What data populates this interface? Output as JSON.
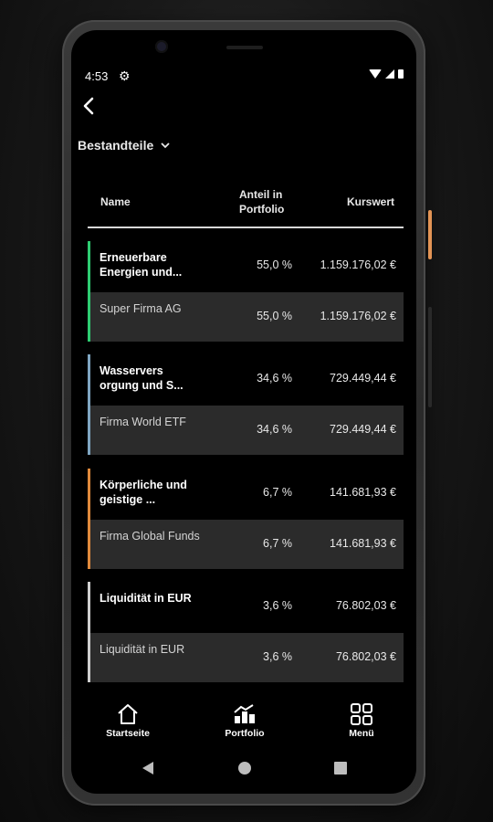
{
  "status_bar": {
    "time": "4:53"
  },
  "header": {
    "section_title": "Bestandteile"
  },
  "table": {
    "columns": {
      "name": "Name",
      "share": "Anteil in Portfolio",
      "value": "Kurswert"
    },
    "groups": [
      {
        "color": "#2ecc71",
        "category": {
          "name": "Erneuerbare Energien und...",
          "share": "55,0 %",
          "value": "1.159.176,02 €"
        },
        "holding": {
          "name": "Super Firma AG",
          "share": "55,0 %",
          "value": "1.159.176,02 €"
        }
      },
      {
        "color": "#7fa6c2",
        "category": {
          "name": "Wasservers orgung und S...",
          "share": "34,6 %",
          "value": "729.449,44 €"
        },
        "holding": {
          "name": "Firma World ETF",
          "share": "34,6 %",
          "value": "729.449,44 €"
        }
      },
      {
        "color": "#e08a3c",
        "category": {
          "name": "Körperliche und geistige ...",
          "share": "6,7 %",
          "value": "141.681,93 €"
        },
        "holding": {
          "name": "Firma Global Funds",
          "share": "6,7 %",
          "value": "141.681,93 €"
        }
      },
      {
        "color": "#cfcfcf",
        "category": {
          "name": "Liquidität in EUR",
          "share": "3,6 %",
          "value": "76.802,03 €"
        },
        "holding": {
          "name": "Liquidität in EUR",
          "share": "3,6 %",
          "value": "76.802,03 €"
        }
      }
    ]
  },
  "bottom_nav": {
    "items": [
      {
        "label": "Startseite",
        "icon": "home-icon"
      },
      {
        "label": "Portfolio",
        "icon": "portfolio-chart-icon"
      },
      {
        "label": "Menü",
        "icon": "grid-menu-icon"
      }
    ]
  },
  "icons": {
    "settings": "gear-icon",
    "back": "back-arrow-icon",
    "dropdown": "chevron-down-icon",
    "system_back": "triangle-back-icon",
    "system_home": "circle-home-icon",
    "system_recents": "square-recents-icon"
  },
  "colors": {
    "accent_side_button": "#e39455",
    "row_dark": "#2b2b2b"
  }
}
